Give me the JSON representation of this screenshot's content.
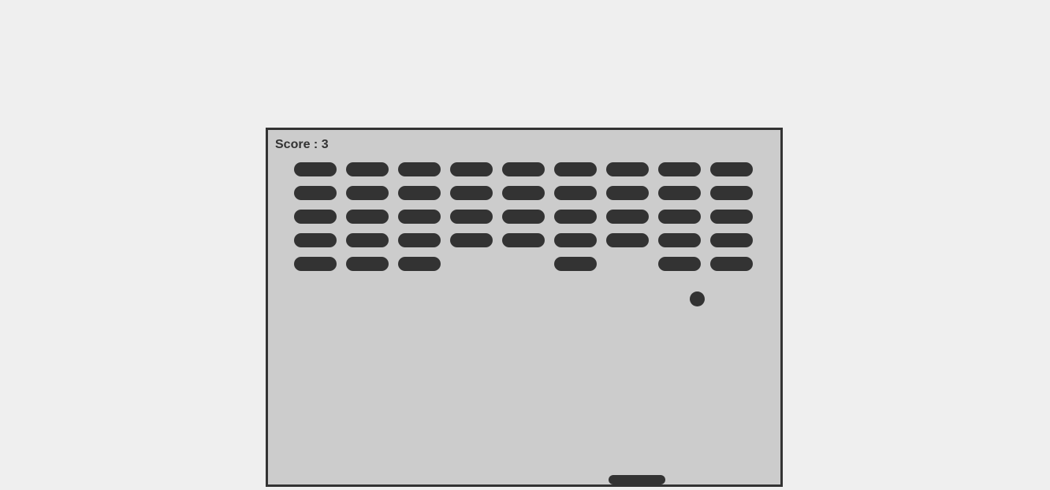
{
  "score": {
    "label": "Score : 3",
    "value": 3
  },
  "colors": {
    "page_background": "#efefef",
    "board_background": "#cccccc",
    "foreground": "#333333"
  },
  "bricks": {
    "rows": 5,
    "columns": 9,
    "present": [
      [
        1,
        1,
        1,
        1,
        1,
        1,
        1,
        1,
        1
      ],
      [
        1,
        1,
        1,
        1,
        1,
        1,
        1,
        1,
        1
      ],
      [
        1,
        1,
        1,
        1,
        1,
        1,
        1,
        1,
        1
      ],
      [
        1,
        1,
        1,
        1,
        1,
        1,
        1,
        1,
        1
      ],
      [
        1,
        1,
        1,
        0,
        0,
        1,
        0,
        1,
        1
      ]
    ]
  }
}
